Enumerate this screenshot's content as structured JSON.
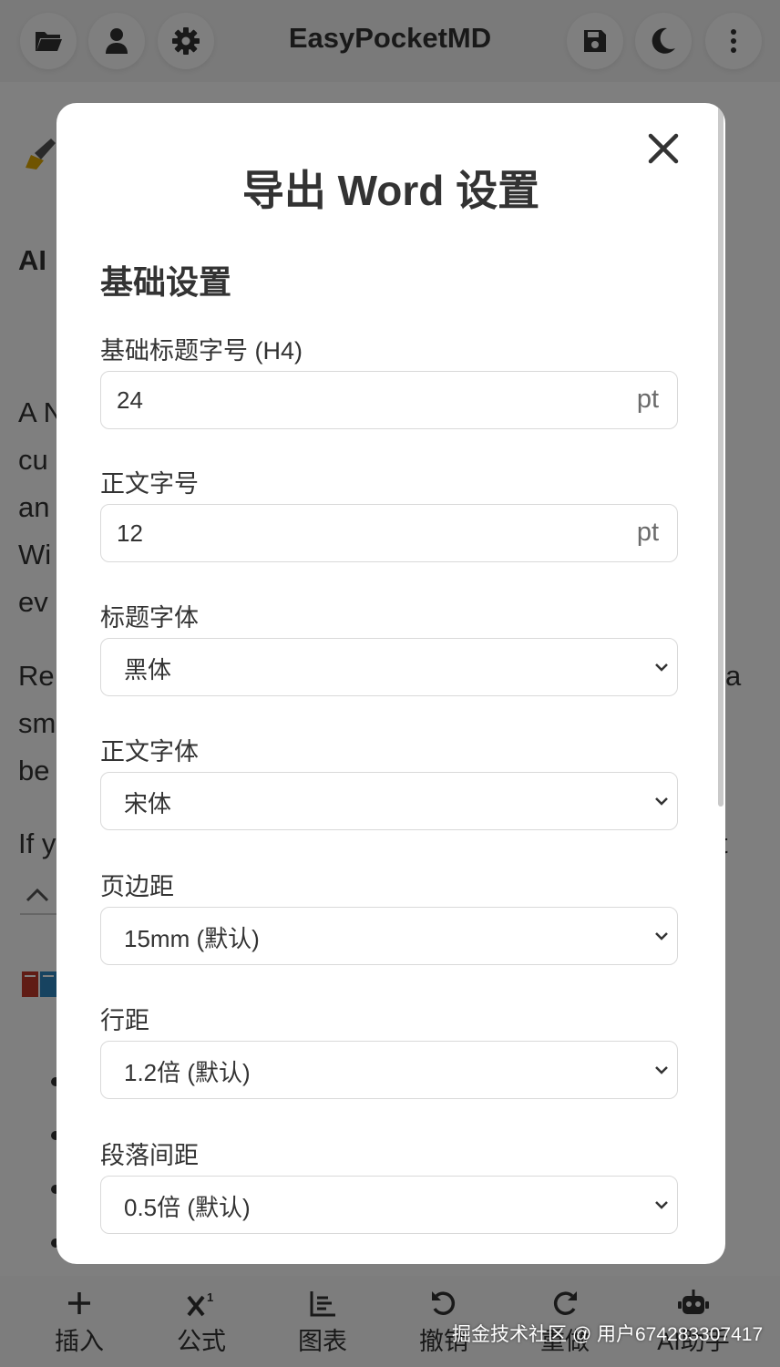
{
  "app": {
    "title": "EasyPocketMD"
  },
  "topbar_icons": [
    "folder-icon",
    "user-icon",
    "gear-icon",
    "save-icon",
    "moon-icon",
    "more-vertical-icon"
  ],
  "background_doc": {
    "heading_prefix": "AI",
    "para1": [
      "A N",
      "cu",
      "an",
      "Wi",
      "ev"
    ],
    "para2": [
      "Re",
      "sm",
      "be"
    ],
    "para2_right": "a",
    "para3": "If y",
    "para3_right": "t"
  },
  "bottom_toolbar": [
    {
      "label": "插入",
      "icon": "plus-icon"
    },
    {
      "label": "公式",
      "icon": "superscript-icon"
    },
    {
      "label": "图表",
      "icon": "chart-icon"
    },
    {
      "label": "撤销",
      "icon": "undo-icon"
    },
    {
      "label": "重做",
      "icon": "redo-icon"
    },
    {
      "label": "AI助手",
      "icon": "robot-icon"
    }
  ],
  "watermark": "掘金技术社区 @ 用户674283307417",
  "modal": {
    "title": "导出 Word 设置",
    "section_title": "基础设置",
    "fields": {
      "heading_size": {
        "label": "基础标题字号 (H4)",
        "value": "24",
        "unit": "pt"
      },
      "body_size": {
        "label": "正文字号",
        "value": "12",
        "unit": "pt"
      },
      "heading_font": {
        "label": "标题字体",
        "selected": "黑体"
      },
      "body_font": {
        "label": "正文字体",
        "selected": "宋体"
      },
      "page_margin": {
        "label": "页边距",
        "selected": "15mm (默认)"
      },
      "line_spacing": {
        "label": "行距",
        "selected": "1.2倍 (默认)"
      },
      "paragraph_spacing": {
        "label": "段落间距",
        "selected": "0.5倍 (默认)"
      }
    }
  },
  "colors": {
    "overlay": "#000000",
    "modal_bg": "#ffffff",
    "text": "#333333",
    "border": "#d9d9d9"
  }
}
